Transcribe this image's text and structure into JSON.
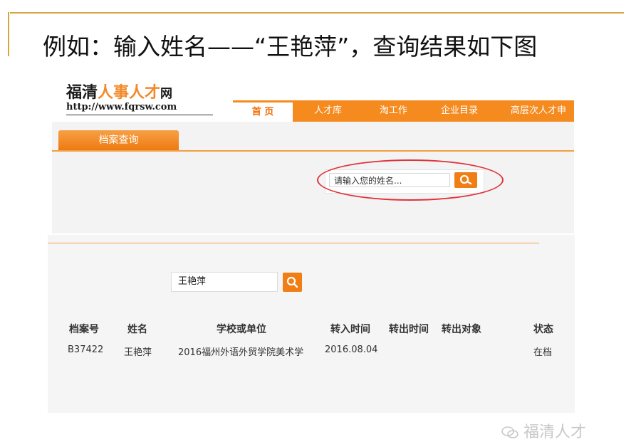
{
  "slide": {
    "title": "例如：输入姓名——“王艳萍”，查询结果如下图"
  },
  "site": {
    "logo_part1": "福清",
    "logo_part2": "人事人才",
    "logo_part3": "网",
    "url": "http://www.fqrsw.com",
    "nav": [
      "首  页",
      "人才库",
      "淘工作",
      "企业目录",
      "高层次人才申"
    ],
    "tab_archive": "档案查询",
    "search_placeholder": "请输入您的姓名...",
    "accent_color": "#f58a1e"
  },
  "result": {
    "search_value": "王艳萍",
    "columns": [
      "档案号",
      "姓名",
      "学校或单位",
      "转入时间",
      "转出时间",
      "转出对象",
      "状态"
    ],
    "rows": [
      [
        "B37422",
        "王艳萍",
        "2016福州外语外贸学院美术学",
        "2016.08.04",
        "",
        "",
        "在档"
      ]
    ]
  },
  "watermark": {
    "text": "福清人才",
    "icon": "wechat-icon"
  }
}
